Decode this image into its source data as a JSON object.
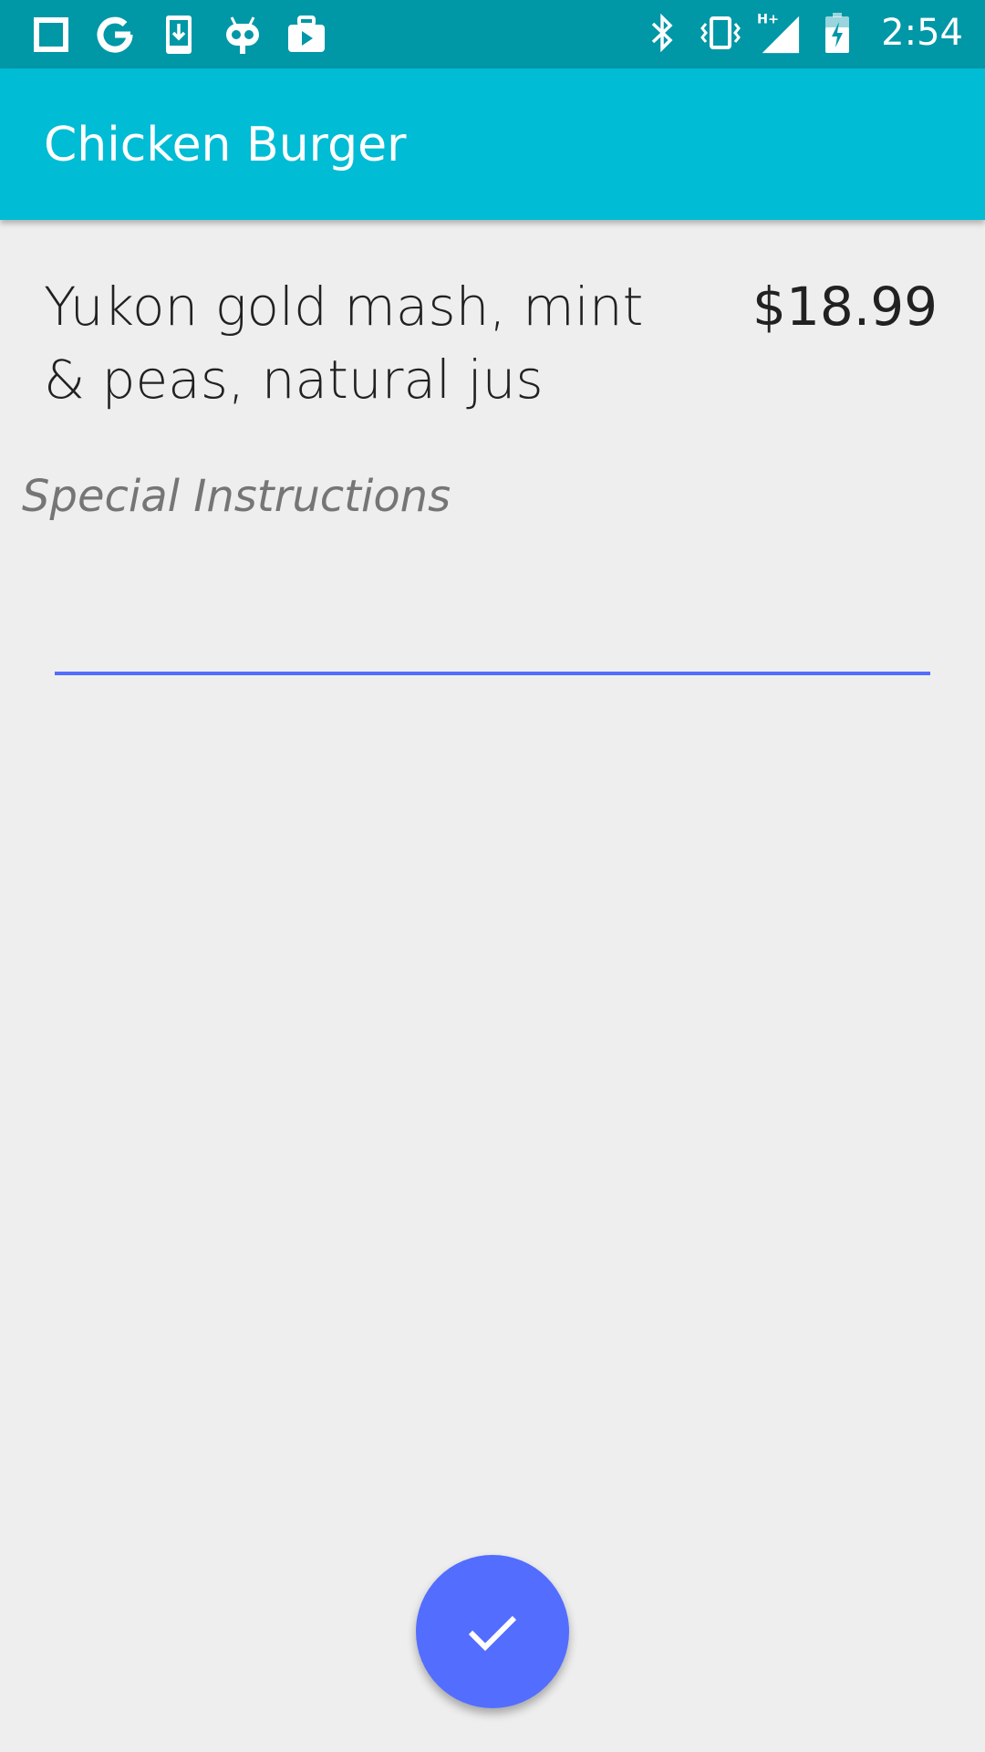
{
  "status_bar": {
    "time": "2:54",
    "left_icons": [
      "square-notification-icon",
      "google-icon",
      "download-phone-icon",
      "android-robot-icon",
      "briefcase-play-icon"
    ],
    "right_icons": [
      "bluetooth-icon",
      "vibrate-icon",
      "hplus-signal-icon",
      "battery-charging-icon"
    ],
    "network_label": "H+"
  },
  "app_bar": {
    "title": "Chicken Burger"
  },
  "item": {
    "description": "Yukon gold mash, mint & peas, natural jus",
    "price": "$18.99"
  },
  "instructions": {
    "label": "Special Instructions",
    "value": "",
    "placeholder": ""
  },
  "fab": {
    "icon": "check-icon"
  },
  "colors": {
    "status_bar": "#0097a7",
    "app_bar": "#00bcd4",
    "accent": "#536dfe",
    "background": "#eeeeee"
  }
}
